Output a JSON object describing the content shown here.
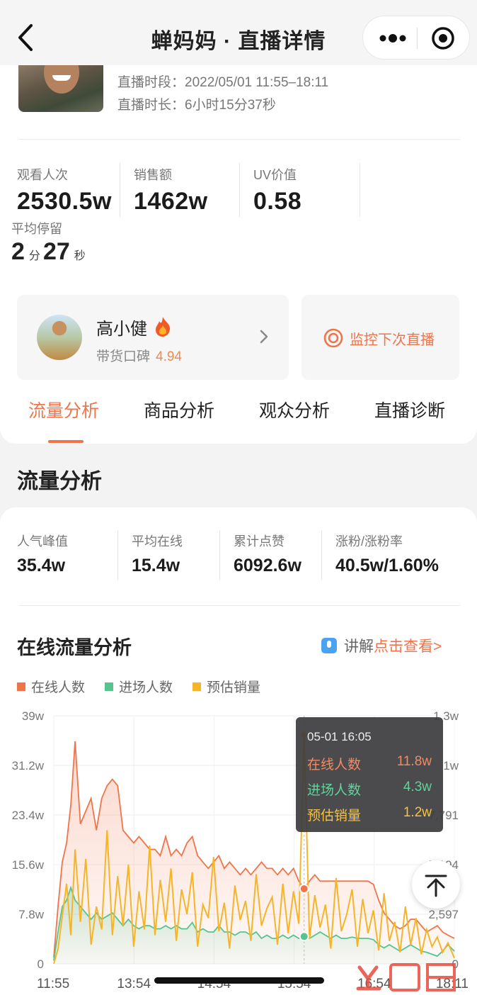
{
  "nav": {
    "title": "蝉妈妈 · 直播详情"
  },
  "header": {
    "period_label": "直播时段：",
    "period_value": "2022/05/01 11:55–18:11",
    "duration_label": "直播时长：",
    "duration_value": "6小时15分37秒"
  },
  "stats": [
    {
      "label": "观看人次",
      "value": "2530.5w"
    },
    {
      "label": "销售额",
      "value": "1462w"
    },
    {
      "label": "UV价值",
      "value": "0.58"
    }
  ],
  "avg_stay": {
    "label": "平均停留",
    "minutes": "2",
    "min_unit": "分",
    "seconds": "27",
    "sec_unit": "秒"
  },
  "host": {
    "name": "高小健",
    "reputation_label": "带货口碑",
    "reputation_score": "4.94"
  },
  "monitor": {
    "label": "监控下次直播"
  },
  "tabs": [
    "流量分析",
    "商品分析",
    "观众分析",
    "直播诊断"
  ],
  "section_title": "流量分析",
  "metrics": [
    {
      "label": "人气峰值",
      "value": "35.4w"
    },
    {
      "label": "平均在线",
      "value": "15.4w"
    },
    {
      "label": "累计点赞",
      "value": "6092.6w"
    },
    {
      "label": "涨粉/涨粉率",
      "value": "40.5w/1.60%"
    }
  ],
  "chart_header": {
    "title": "在线流量分析",
    "explain_prefix": "讲解",
    "explain_link": "点击查看>"
  },
  "colors": {
    "online": "#f0744a",
    "entry": "#56c48f",
    "sales": "#f5b52a",
    "accent": "#f0744a"
  },
  "chart_data": {
    "type": "line",
    "legend": [
      "在线人数",
      "进场人数",
      "预估销量"
    ],
    "x_ticks": [
      "11:55",
      "13:54",
      "14:54",
      "15:54",
      "16:54",
      "18:11"
    ],
    "y_left_ticks": [
      "39w",
      "31.2w",
      "23.4w",
      "15.6w",
      "7.8w",
      "0"
    ],
    "y_right_ticks": [
      "1.3w",
      "1w",
      "7,791",
      "5,194",
      "2,597",
      "0"
    ],
    "ylim_left": [
      0,
      39
    ],
    "ylim_right": [
      0,
      13000
    ],
    "x_minutes": [
      0,
      4,
      8,
      12,
      16,
      20,
      25,
      30,
      35,
      40,
      45,
      50,
      55,
      60,
      65,
      70,
      75,
      80,
      85,
      90,
      95,
      100,
      105,
      110,
      115,
      120,
      125,
      130,
      135,
      140,
      145,
      150,
      155,
      160,
      165,
      170,
      175,
      180,
      185,
      190,
      195,
      200,
      205,
      210,
      215,
      220,
      225,
      230,
      235,
      240,
      245,
      250,
      255,
      260,
      265,
      270,
      275,
      280,
      285,
      290,
      295,
      300,
      305,
      310,
      315,
      320,
      325,
      330,
      335,
      340,
      345,
      350,
      355,
      360,
      365,
      370,
      376
    ],
    "series": [
      {
        "name": "在线人数",
        "values": [
          1,
          9,
          16,
          19,
          25,
          35,
          22,
          24,
          26,
          21,
          26,
          28,
          29,
          28,
          21,
          20,
          19,
          20,
          19,
          18,
          18,
          17,
          20,
          17,
          18,
          17,
          19,
          20,
          17,
          16,
          15,
          16,
          17,
          15,
          16,
          15,
          14,
          15,
          14,
          15,
          16,
          15,
          15,
          14,
          15,
          14,
          15,
          13,
          11.8,
          13,
          14,
          13,
          13,
          13,
          13,
          13,
          13,
          13,
          13,
          13,
          13,
          12.5,
          10,
          8,
          7,
          6,
          5.5,
          6,
          7,
          7,
          6,
          5,
          5.5,
          6,
          5,
          4.5,
          4
        ]
      },
      {
        "name": "进场人数",
        "values": [
          0.5,
          5,
          9,
          10,
          12,
          10,
          9,
          8,
          7,
          8,
          7,
          7.5,
          8,
          7,
          6,
          7,
          6,
          5.5,
          6,
          6,
          5.5,
          5.5,
          6,
          5.5,
          6,
          5.5,
          5.5,
          6.5,
          5,
          5.5,
          5,
          5,
          6,
          5,
          5,
          4.5,
          5,
          5,
          4.5,
          5,
          4,
          4.5,
          4,
          4,
          4.5,
          4,
          4.5,
          4,
          4.3,
          4,
          4.5,
          5,
          4.5,
          4,
          4.5,
          4,
          4,
          4.2,
          4,
          4,
          4,
          3.8,
          3,
          2.5,
          3,
          2.5,
          2,
          2.5,
          3,
          2.5,
          2,
          1.8,
          1.5,
          1.2,
          2,
          3,
          2
        ]
      },
      {
        "name": "预估销量",
        "values": [
          0,
          800,
          2500,
          4200,
          1500,
          6000,
          2200,
          5500,
          1000,
          3000,
          1800,
          7000,
          1500,
          4600,
          2000,
          5200,
          900,
          3800,
          1800,
          6200,
          1500,
          4400,
          2200,
          5000,
          1200,
          3900,
          2600,
          4800,
          900,
          3100,
          2400,
          5600,
          1700,
          3200,
          800,
          4100,
          2300,
          3300,
          1200,
          4700,
          2000,
          2900,
          3500,
          1000,
          4200,
          1600,
          3800,
          2100,
          12000,
          1300,
          3600,
          1900,
          3100,
          800,
          4500,
          1700,
          2600,
          3900,
          900,
          3400,
          1600,
          2800,
          700,
          3700,
          1200,
          2200,
          600,
          3000,
          1000,
          2400,
          500,
          1800,
          900,
          1400,
          600,
          1100,
          300
        ]
      }
    ]
  },
  "tooltip": {
    "time": "05-01 16:05",
    "rows": [
      {
        "label": "在线人数",
        "value": "11.8w"
      },
      {
        "label": "进场人数",
        "value": "4.3w"
      },
      {
        "label": "预估销量",
        "value": "1.2w"
      }
    ]
  }
}
